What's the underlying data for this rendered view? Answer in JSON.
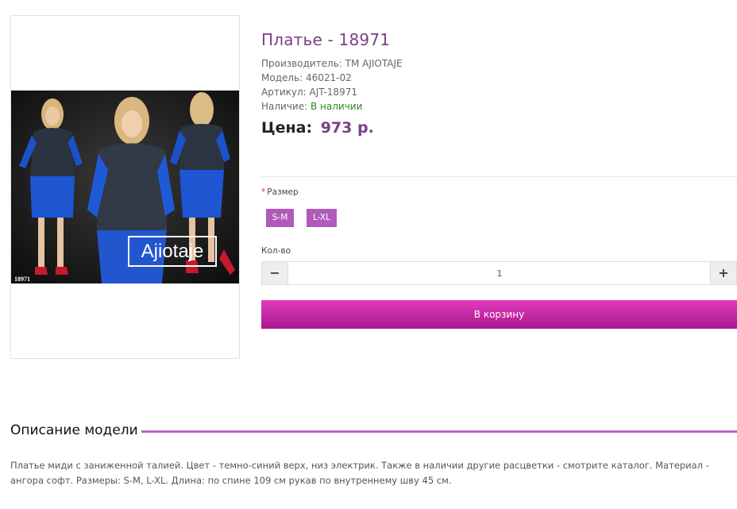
{
  "product": {
    "title": "Платье - 18971",
    "manufacturer": "Производитель: ТМ AJIOTAJE",
    "model": "Модель: 46021-02",
    "sku": "Артикул: AJT-18971",
    "availability_label": "Наличие:",
    "availability_value": "В наличии",
    "price_label": "Цена:",
    "price_value": "973 р.",
    "image": {
      "brand_text": "Ajiotaje",
      "code_text": "18971"
    }
  },
  "options": {
    "size_required_mark": "*",
    "size_label": "Размер",
    "sizes": [
      "S-M",
      "L-XL"
    ]
  },
  "quantity": {
    "label": "Кол-во",
    "minus": "−",
    "value": "1",
    "plus": "+"
  },
  "cart_button": "В корзину",
  "description": {
    "heading": "Описание модели",
    "text": "Платье миди с заниженной талией. Цвет - темно-синий верх, низ электрик. Также в наличии другие расцветки - смотрите каталог. Материал - ангора софт. Размеры: S-M, L-XL. Длина: по спине 109 см рукав по внутреннему шву 45 см."
  },
  "colors": {
    "accent": "#7b3f86",
    "button": "#c0259f",
    "size_chip": "#b05ab9",
    "in_stock": "#2e8b1e"
  }
}
